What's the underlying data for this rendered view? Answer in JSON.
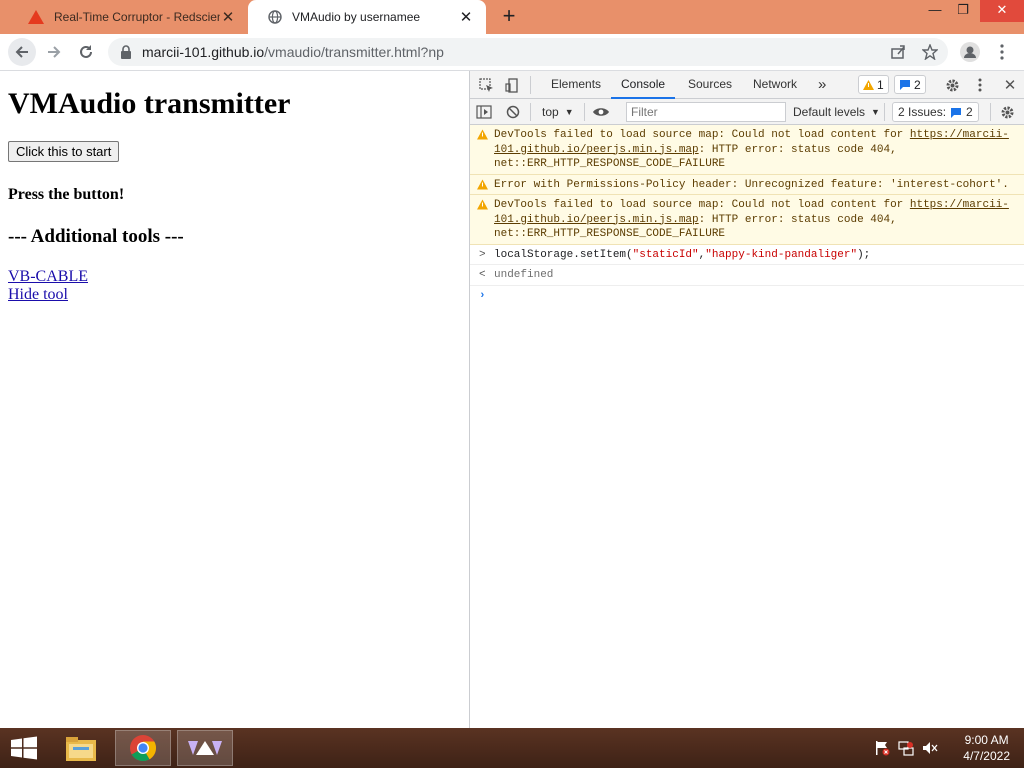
{
  "browser": {
    "tabs": [
      {
        "title": "Real-Time Corruptor - Redscientist",
        "active": false,
        "icon": "warning-red-icon"
      },
      {
        "title": "VMAudio by usernamee",
        "active": true,
        "icon": "globe-icon"
      }
    ],
    "new_tab": "+",
    "window_controls": {
      "minimize": "—",
      "maximize": "❐",
      "close": "✕"
    },
    "address": {
      "host": "marcii-101.github.io",
      "path": "/vmaudio/transmitter.html?np"
    }
  },
  "page": {
    "title": "VMAudio transmitter",
    "start_button": "Click this to start",
    "status": "Press the button!",
    "tools_heading": "--- Additional tools ---",
    "links": [
      "VB-CABLE",
      "Hide tool"
    ]
  },
  "devtools": {
    "tabs": [
      "Elements",
      "Console",
      "Sources",
      "Network"
    ],
    "more_tabs": "»",
    "warnings_count": "1",
    "messages_count": "2",
    "console_bar": {
      "context": "top",
      "filter_placeholder": "Filter",
      "levels": "Default levels",
      "issues_label": "2 Issues:",
      "issues_count": "2"
    },
    "messages": [
      {
        "type": "warn",
        "pre": "DevTools failed to load source map: Could not load content for ",
        "link": "https://marcii-101.github.io/peerjs.min.js.map",
        "post": ": HTTP error: status code 404, net::ERR_HTTP_RESPONSE_CODE_FAILURE"
      },
      {
        "type": "warn",
        "text": "Error with Permissions-Policy header: Unrecognized feature: 'interest-cohort'."
      },
      {
        "type": "warn",
        "pre": "DevTools failed to load source map: Could not load content for ",
        "link": "https://marcii-101.github.io/peerjs.min.js.map",
        "post": ": HTTP error: status code 404, net::ERR_HTTP_RESPONSE_CODE_FAILURE"
      }
    ],
    "input": {
      "code_pre": "localStorage.setItem(",
      "arg1": "\"staticId\"",
      "comma": ",",
      "arg2": "\"happy-kind-pandaliger\"",
      "code_post": ");"
    },
    "result": "undefined"
  },
  "taskbar": {
    "time": "9:00 AM",
    "date": "4/7/2022"
  },
  "colors": {
    "tabstrip": "#e8906a",
    "accent": "#1a73e8",
    "warning_bg": "#fffbe5",
    "taskbar": "#4a2a1c"
  }
}
